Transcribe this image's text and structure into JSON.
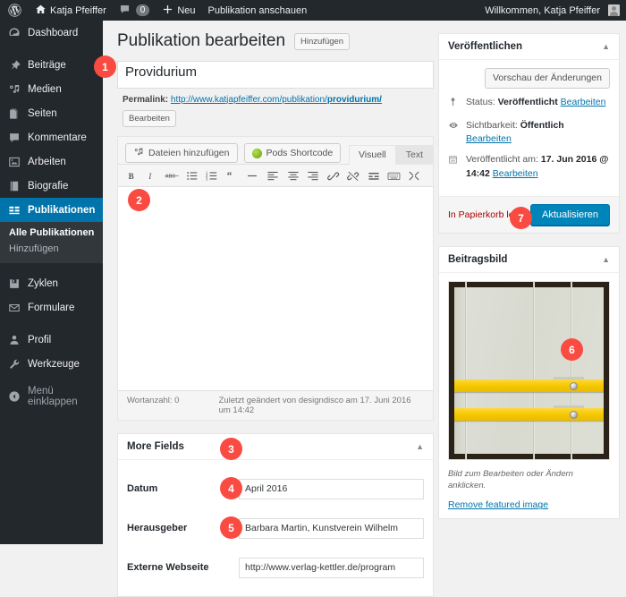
{
  "adminbar": {
    "logo_icon": "wordpress-icon",
    "home_icon": "home-icon",
    "site_name": "Katja Pfeiffer",
    "comments_icon": "comment-icon",
    "comments_count": "0",
    "new_icon": "plus-icon",
    "new_label": "Neu",
    "view_label": "Publikation anschauen",
    "greeting": "Willkommen, Katja Pfeiffer",
    "avatar_icon": "avatar-icon"
  },
  "sidebar": {
    "items": [
      {
        "label": "Dashboard",
        "icon": "dashboard-icon",
        "current": false
      },
      {
        "label": "Beiträge",
        "icon": "pin-icon",
        "current": false
      },
      {
        "label": "Medien",
        "icon": "media-icon",
        "current": false
      },
      {
        "label": "Seiten",
        "icon": "pages-icon",
        "current": false
      },
      {
        "label": "Kommentare",
        "icon": "comment-icon",
        "current": false
      },
      {
        "label": "Arbeiten",
        "icon": "image-icon",
        "current": false
      },
      {
        "label": "Biografie",
        "icon": "book-icon",
        "current": false
      },
      {
        "label": "Publikationen",
        "icon": "grid-icon",
        "current": true
      }
    ],
    "submenu": [
      {
        "label": "Alle Publikationen",
        "active": true
      },
      {
        "label": "Hinzufügen",
        "active": false
      }
    ],
    "items2": [
      {
        "label": "Zyklen",
        "icon": "archive-icon"
      },
      {
        "label": "Formulare",
        "icon": "mail-icon"
      }
    ],
    "items3": [
      {
        "label": "Profil",
        "icon": "user-icon"
      },
      {
        "label": "Werkzeuge",
        "icon": "wrench-icon"
      }
    ],
    "collapse": {
      "label": "Menü einklappen",
      "icon": "collapse-arrow-icon"
    }
  },
  "page": {
    "title": "Publikation bearbeiten",
    "add_new_label": "Hinzufügen"
  },
  "title_field": {
    "value": "Providurium"
  },
  "permalink": {
    "label": "Permalink:",
    "url_prefix": "http://www.katjapfeiffer.com/publikation/",
    "url_slug": "providurium/",
    "edit_label": "Bearbeiten"
  },
  "editor": {
    "add_media_label": "Dateien hinzufügen",
    "add_media_icon": "media-icon",
    "pods_label": "Pods Shortcode",
    "pods_icon": "pods-icon",
    "tab_visual": "Visuell",
    "tab_text": "Text",
    "toolbar_icons": [
      "bold-icon",
      "italic-icon",
      "strikethrough-icon",
      "unordered-list-icon",
      "ordered-list-icon",
      "blockquote-icon",
      "horizontal-rule-icon",
      "align-left-icon",
      "align-center-icon",
      "align-right-icon",
      "link-icon",
      "unlink-icon",
      "read-more-icon",
      "keyboard-shortcuts-icon",
      "fullscreen-icon"
    ],
    "content": "",
    "word_count_label": "Wortanzahl: 0",
    "last_edited": "Zuletzt geändert von designdisco am 17. Juni 2016 um 14:42"
  },
  "more_fields": {
    "title": "More Fields",
    "toggle_icon": "chevron-up-icon",
    "rows": [
      {
        "label": "Datum",
        "value": "April 2016"
      },
      {
        "label": "Herausgeber",
        "value": "Barbara Martin, Kunstverein Wilhelm"
      },
      {
        "label": "Externe Webseite",
        "value": "http://www.verlag-kettler.de/program"
      }
    ]
  },
  "publish_panel": {
    "title": "Veröffentlichen",
    "toggle_icon": "chevron-up-icon",
    "preview_label": "Vorschau der Änderungen",
    "status_icon": "pin-icon",
    "status_label": "Status:",
    "status_value": "Veröffentlicht",
    "status_edit": "Bearbeiten",
    "visibility_icon": "eye-icon",
    "visibility_label": "Sichtbarkeit:",
    "visibility_value": "Öffentlich",
    "visibility_edit": "Bearbeiten",
    "date_icon": "calendar-icon",
    "date_label": "Veröffentlicht am:",
    "date_value": "17. Jun 2016 @ 14:42",
    "date_edit": "Bearbeiten",
    "trash_label": "In Papierkorb legen",
    "update_label": "Aktualisieren"
  },
  "featured_image": {
    "title": "Beitragsbild",
    "toggle_icon": "chevron-up-icon",
    "image_alt": "Buch mit zwei gelben Gurten",
    "caption": "Bild zum Bearbeiten oder Ändern anklicken.",
    "remove_label": "Remove featured image"
  },
  "badges": [
    {
      "id": "b1",
      "number": "1"
    },
    {
      "id": "b2",
      "number": "2"
    },
    {
      "id": "b3",
      "number": "3"
    },
    {
      "id": "b4",
      "number": "4"
    },
    {
      "id": "b5",
      "number": "5"
    },
    {
      "id": "b6",
      "number": "6"
    },
    {
      "id": "b7",
      "number": "7"
    }
  ],
  "colors": {
    "badge": "#fa4b42",
    "admin_bar": "#23282d",
    "accent": "#0073aa",
    "primary_button": "#0085ba",
    "link": "#0073aa",
    "trash": "#a00"
  }
}
